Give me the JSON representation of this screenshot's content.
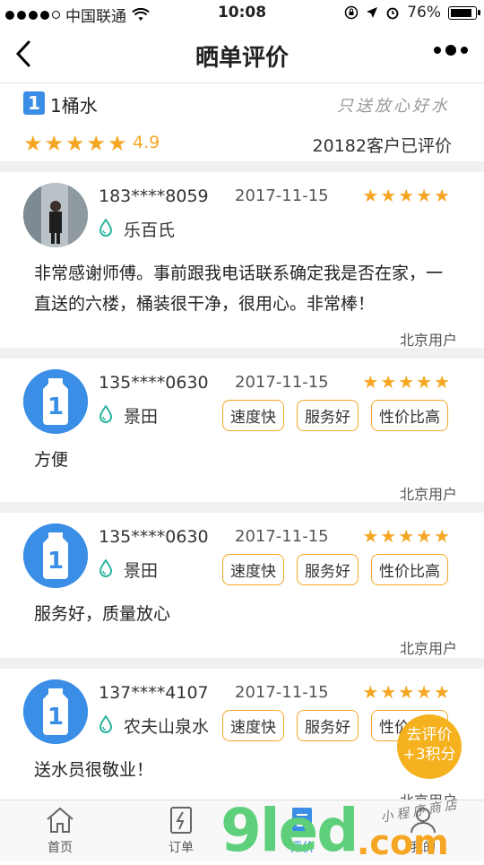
{
  "status_bar": {
    "carrier": "中国联通",
    "time": "10:08",
    "battery_percent": "76%",
    "battery_level": 0.76
  },
  "nav": {
    "title": "晒单评价",
    "back_icon": "chevron-left-icon",
    "more_icon": "more-dots-icon"
  },
  "summary": {
    "product_name": "1桶水",
    "slogan": "只送放心好水",
    "rating": "4.9",
    "review_count": "20182客户已评价",
    "stars": 5
  },
  "reviews": [
    {
      "phone": "183****8059",
      "date": "2017-11-15",
      "brand": "乐百氏",
      "stars": 5,
      "tags": [],
      "text": "非常感谢师傅。事前跟我电话联系确定我是否在家，一直送的六楼，桶装很干净，很用心。非常棒！",
      "location": "北京用户",
      "avatar": "photo"
    },
    {
      "phone": "135****0630",
      "date": "2017-11-15",
      "brand": "景田",
      "stars": 5,
      "tags": [
        "速度快",
        "服务好",
        "性价比高"
      ],
      "text": "方便",
      "location": "北京用户",
      "avatar": "logo"
    },
    {
      "phone": "135****0630",
      "date": "2017-11-15",
      "brand": "景田",
      "stars": 5,
      "tags": [
        "速度快",
        "服务好",
        "性价比高"
      ],
      "text": "服务好，质量放心",
      "location": "北京用户",
      "avatar": "logo"
    },
    {
      "phone": "137****4107",
      "date": "2017-11-15",
      "brand": "农夫山泉水",
      "stars": 5,
      "tags": [
        "速度快",
        "服务好",
        "性价比高"
      ],
      "text": "送水员很敬业！",
      "location": "北京用户",
      "avatar": "logo"
    }
  ],
  "floating_button": {
    "line1": "去评价",
    "line2": "+3积分"
  },
  "tabbar": {
    "items": [
      {
        "label": "首页",
        "icon": "home-icon"
      },
      {
        "label": "订单",
        "icon": "order-icon"
      },
      {
        "label": "评价",
        "icon": "review-icon",
        "active": true
      },
      {
        "label": "我的",
        "icon": "profile-icon"
      }
    ]
  },
  "watermark": {
    "text": "9led",
    "domain": ".com",
    "shop": "小程序商店"
  },
  "colors": {
    "accent_orange": "#f5a623",
    "brand_blue": "#3a8ee6",
    "water_drop": "#2bb5a0"
  }
}
